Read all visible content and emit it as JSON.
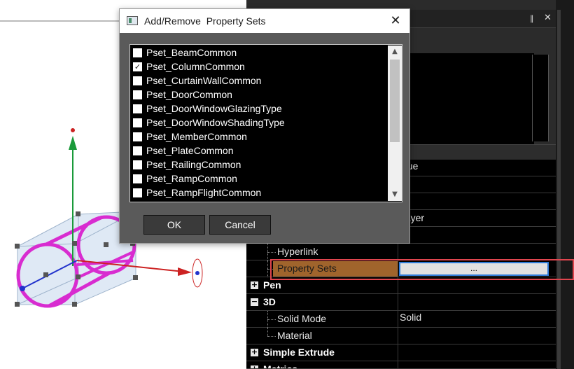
{
  "dialog": {
    "title": "Add/Remove  Property Sets",
    "ok_label": "OK",
    "cancel_label": "Cancel",
    "property_sets": [
      {
        "label": "Pset_BeamCommon",
        "checked": false
      },
      {
        "label": "Pset_ColumnCommon",
        "checked": true
      },
      {
        "label": "Pset_CurtainWallCommon",
        "checked": false
      },
      {
        "label": "Pset_DoorCommon",
        "checked": false
      },
      {
        "label": "Pset_DoorWindowGlazingType",
        "checked": false
      },
      {
        "label": "Pset_DoorWindowShadingType",
        "checked": false
      },
      {
        "label": "Pset_MemberCommon",
        "checked": false
      },
      {
        "label": "Pset_PlateCommon",
        "checked": false
      },
      {
        "label": "Pset_RailingCommon",
        "checked": false
      },
      {
        "label": "Pset_RampCommon",
        "checked": false
      },
      {
        "label": "Pset_RampFlightCommon",
        "checked": false
      }
    ]
  },
  "panel": {
    "pin_glyph": "∥",
    "close_glyph": "✕",
    "value_header": "alue",
    "layer_value": "Layer",
    "hyperlink_label": "Hyperlink",
    "property_sets_label": "Property Sets",
    "property_sets_button": "...",
    "pen_label": "Pen",
    "threed_label": "3D",
    "solid_mode_label": "Solid Mode",
    "solid_mode_value": "Solid",
    "material_label": "Material",
    "simple_extrude_label": "Simple Extrude",
    "metrics_label": "Metrics"
  },
  "icons": {
    "collapse": "−",
    "expand": "+",
    "check": "✓",
    "scroll_up": "▲",
    "scroll_down": "▼",
    "close": "✕"
  },
  "colors": {
    "selection": "#a0642c",
    "focus": "#2f7bd8",
    "highlight": "#e0454e",
    "cylinder": "#d82cd0"
  }
}
